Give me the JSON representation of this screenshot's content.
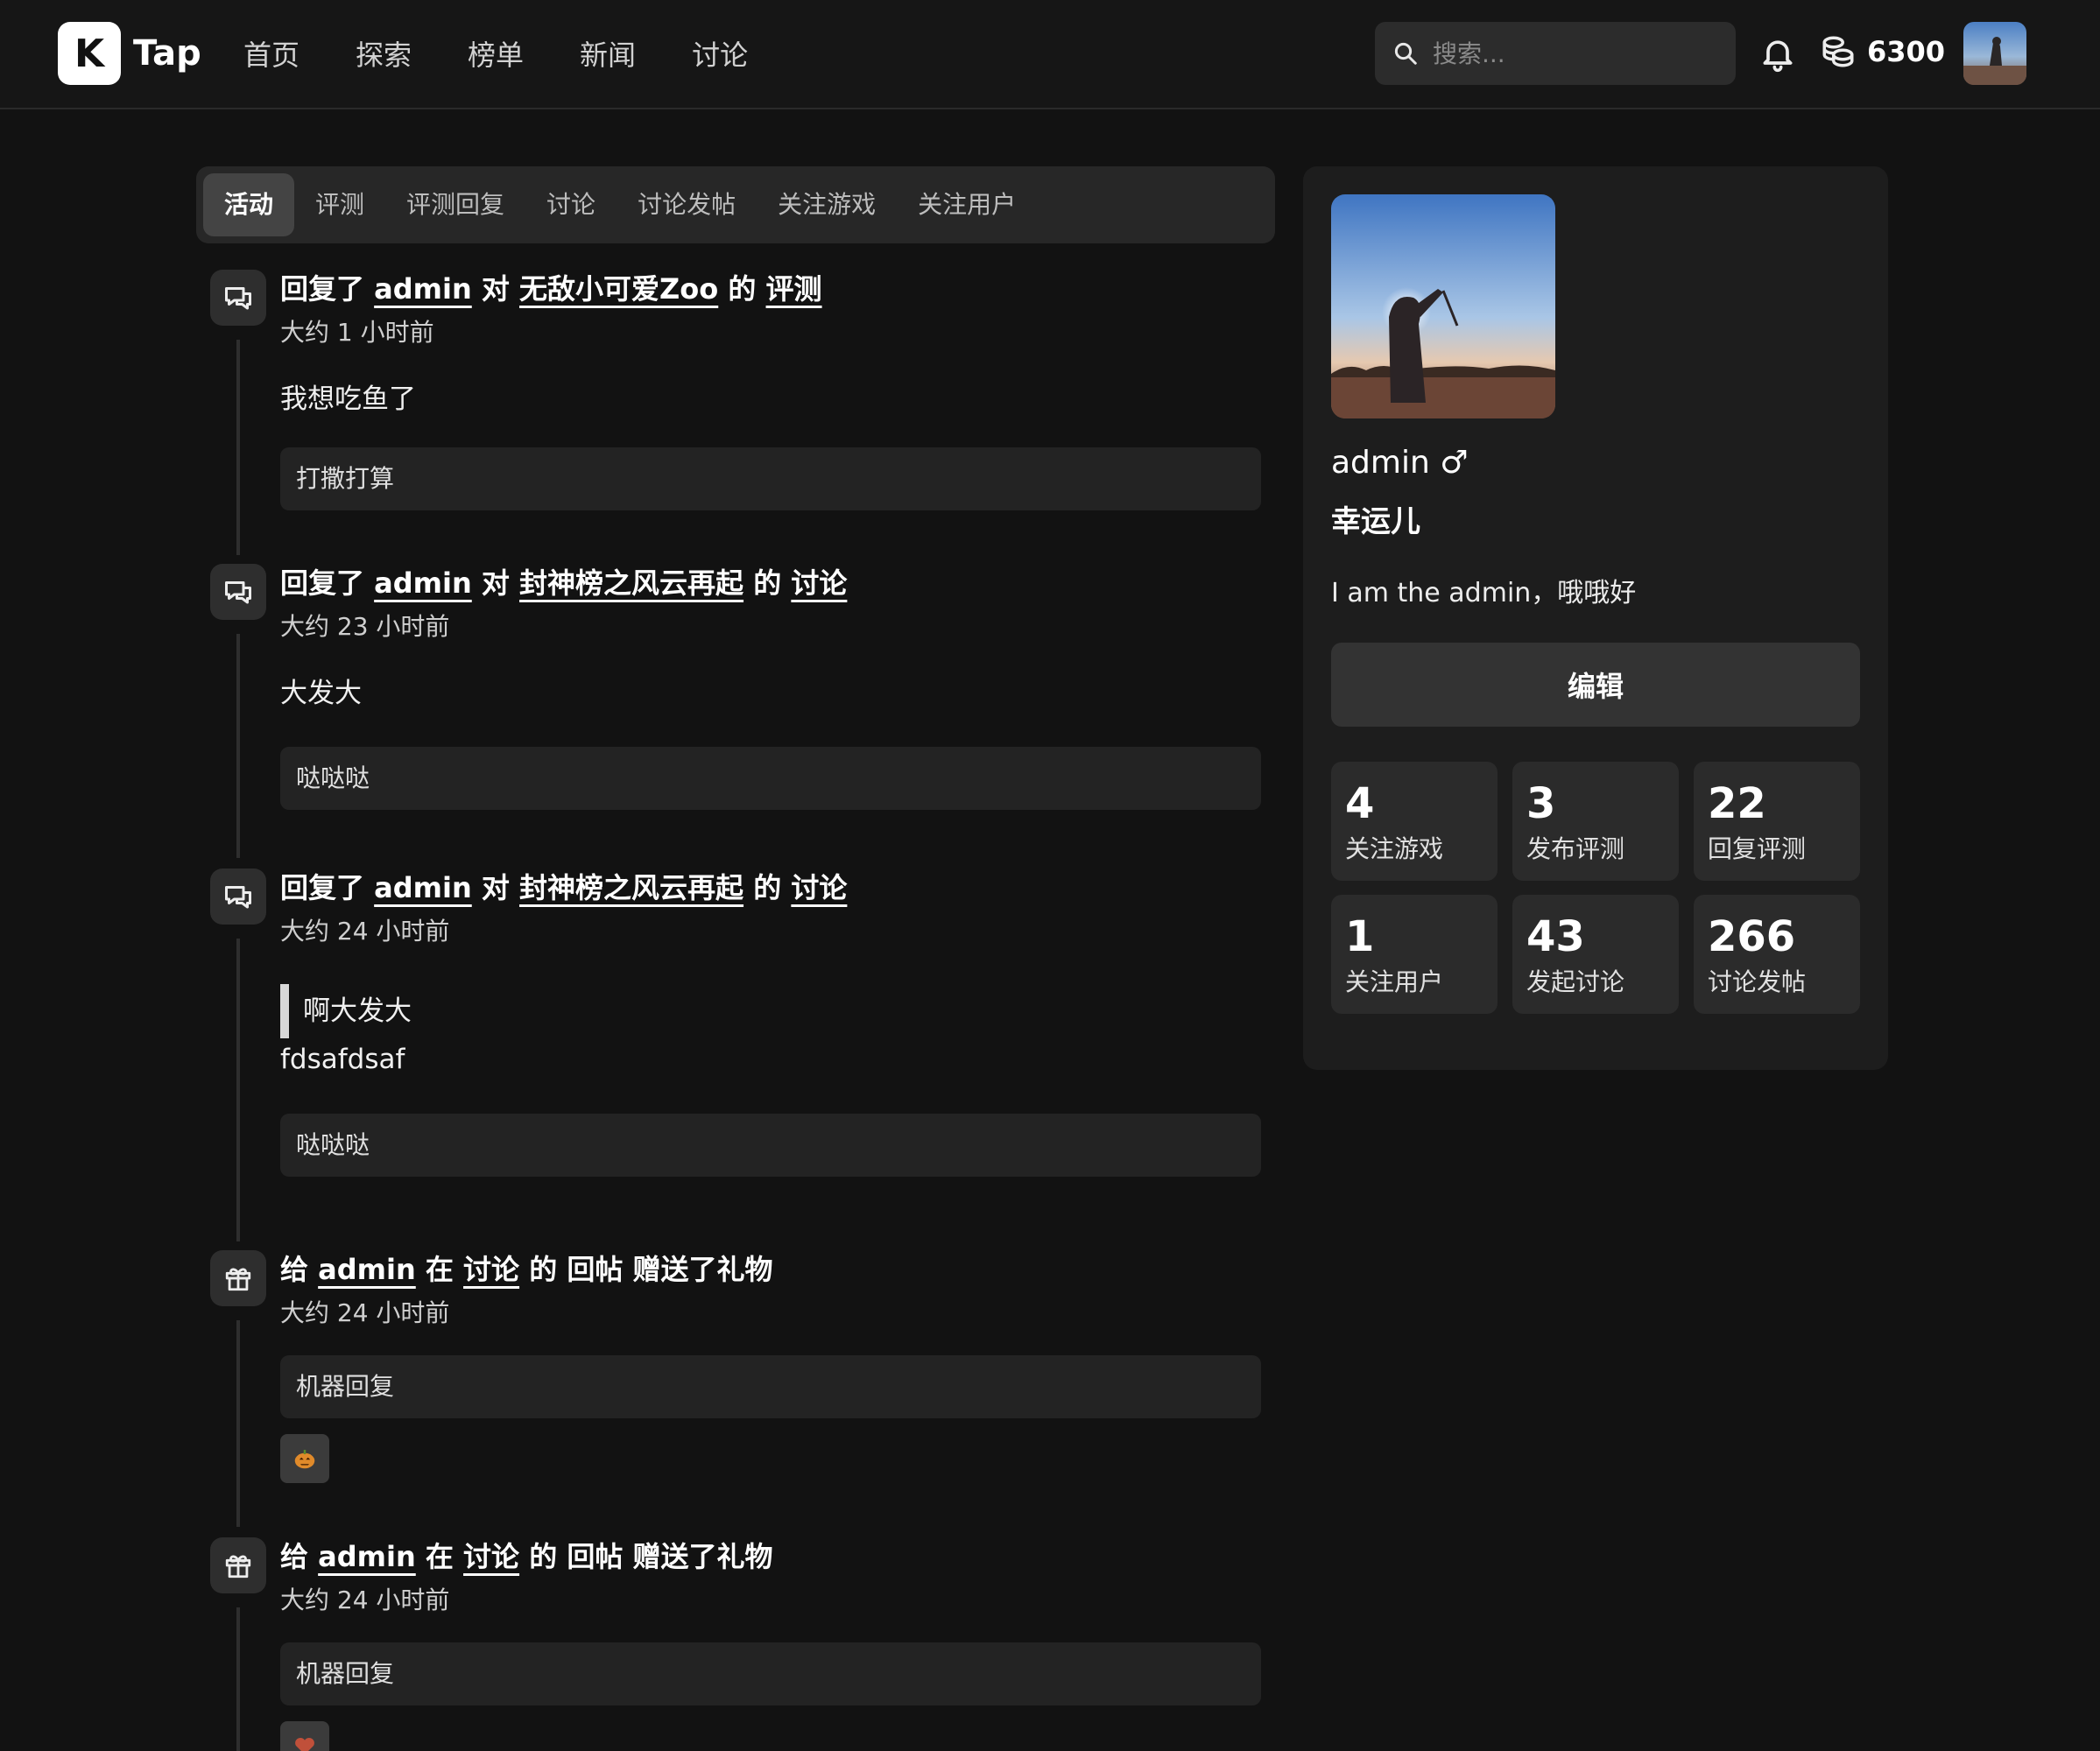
{
  "header": {
    "logo_letter": "K",
    "logo_text": "Tap",
    "nav": [
      "首页",
      "探索",
      "榜单",
      "新闻",
      "讨论"
    ],
    "search_placeholder": "搜索...",
    "coins": "6300"
  },
  "tabs": [
    "活动",
    "评测",
    "评测回复",
    "讨论",
    "讨论发帖",
    "关注游戏",
    "关注用户"
  ],
  "active_tab": "活动",
  "feed": [
    {
      "icon": "chat-bubbles-icon",
      "pre": "回复了",
      "user": "admin",
      "mid": "对",
      "target": "无敌小可爱Zoo",
      "of": "的",
      "type": "评测",
      "time": "大约 1 小时前",
      "content": "我想吃鱼了",
      "ref": "打撒打算"
    },
    {
      "icon": "chat-bubbles-icon",
      "pre": "回复了",
      "user": "admin",
      "mid": "对",
      "target": "封神榜之风云再起",
      "of": "的",
      "type": "讨论",
      "time": "大约 23 小时前",
      "content": "大发大",
      "ref": "哒哒哒"
    },
    {
      "icon": "chat-bubbles-icon",
      "pre": "回复了",
      "user": "admin",
      "mid": "对",
      "target": "封神榜之风云再起",
      "of": "的",
      "type": "讨论",
      "time": "大约 24 小时前",
      "quote": "啊大发大",
      "content": "fdsafdsaf",
      "ref": "哒哒哒"
    },
    {
      "icon": "gift-icon",
      "pre": "给",
      "user": "admin",
      "mid": "在",
      "target": "讨论",
      "of": "的",
      "suffix": "回帖 赠送了礼物",
      "time": "大约 24 小时前",
      "ref": "机器回复",
      "gift": "pumpkin-gift-icon"
    },
    {
      "icon": "gift-icon",
      "pre": "给",
      "user": "admin",
      "mid": "在",
      "target": "讨论",
      "of": "的",
      "suffix": "回帖 赠送了礼物",
      "time": "大约 24 小时前",
      "ref": "机器回复",
      "gift": "heart-gift-icon"
    }
  ],
  "profile": {
    "name": "admin ♂",
    "title": "幸运儿",
    "bio": "I am the admin，哦哦好",
    "edit_label": "编辑",
    "stats": [
      {
        "num": "4",
        "label": "关注游戏"
      },
      {
        "num": "3",
        "label": "发布评测"
      },
      {
        "num": "22",
        "label": "回复评测"
      },
      {
        "num": "1",
        "label": "关注用户"
      },
      {
        "num": "43",
        "label": "发起讨论"
      },
      {
        "num": "266",
        "label": "讨论发帖"
      }
    ]
  },
  "colors": {
    "background": "#121212",
    "card": "#1d1d1d",
    "accent": "#ffffff"
  }
}
